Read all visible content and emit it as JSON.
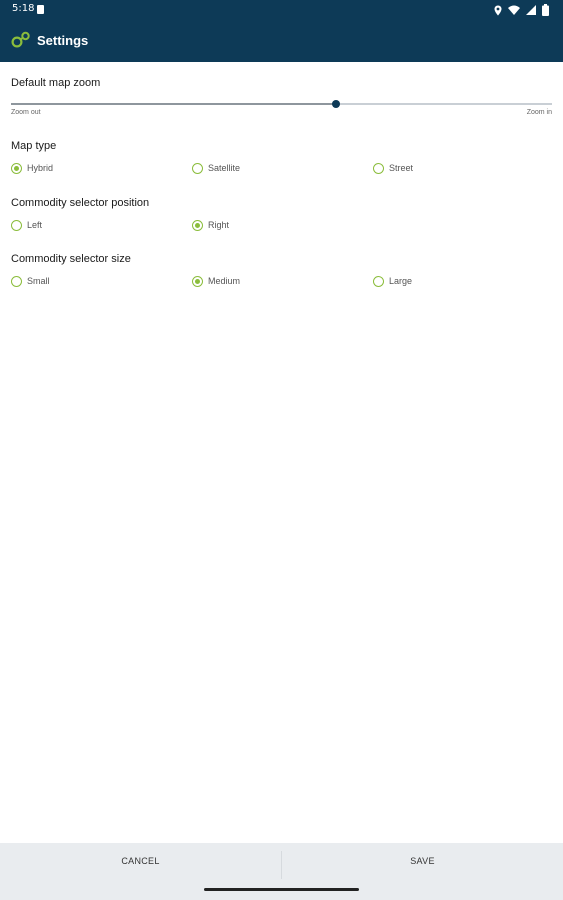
{
  "status_bar": {
    "time": "5:18",
    "icons": [
      "sd-card-icon",
      "location-icon",
      "wifi-icon",
      "signal-icon",
      "battery-icon"
    ]
  },
  "app_bar": {
    "title": "Settings",
    "logo_icon": "app-logo-icon"
  },
  "zoom": {
    "title": "Default map zoom",
    "min_label": "Zoom out",
    "max_label": "Zoom in",
    "value_fraction": 0.6
  },
  "map_type": {
    "title": "Map type",
    "options": [
      {
        "label": "Hybrid",
        "checked": true
      },
      {
        "label": "Satellite",
        "checked": false
      },
      {
        "label": "Street",
        "checked": false
      }
    ]
  },
  "selector_position": {
    "title": "Commodity selector position",
    "options": [
      {
        "label": "Left",
        "checked": false
      },
      {
        "label": "Right",
        "checked": true
      }
    ]
  },
  "selector_size": {
    "title": "Commodity selector size",
    "options": [
      {
        "label": "Small",
        "checked": false
      },
      {
        "label": "Medium",
        "checked": true
      },
      {
        "label": "Large",
        "checked": false
      }
    ]
  },
  "actions": {
    "cancel": "CANCEL",
    "save": "SAVE"
  },
  "colors": {
    "header": "#0d3a57",
    "accent": "#8bbd3c",
    "bottom_bar": "#e9ecef"
  }
}
